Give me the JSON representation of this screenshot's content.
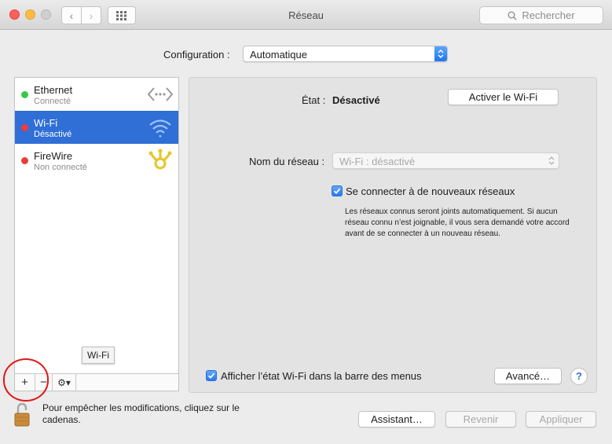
{
  "window": {
    "title": "Réseau"
  },
  "toolbar": {
    "back_glyph": "‹",
    "forward_glyph": "›",
    "grid_icon": "grid-icon",
    "search_placeholder": "Rechercher"
  },
  "config": {
    "label": "Configuration :",
    "value": "Automatique"
  },
  "services": [
    {
      "name": "Ethernet",
      "status": "Connecté",
      "dot_color": "#35c94a",
      "icon": "ethernet-icon"
    },
    {
      "name": "Wi-Fi",
      "status": "Désactivé",
      "dot_color": "#ee3b3b",
      "icon": "wifi-icon",
      "selected": true
    },
    {
      "name": "FireWire",
      "status": "Non connecté",
      "dot_color": "#ee3b3b",
      "icon": "firewire-icon"
    }
  ],
  "sidebar_footer": {
    "add": "+",
    "remove": "−",
    "action": "⚙▾"
  },
  "tooltip": "Wi-Fi",
  "detail": {
    "state_label": "État :",
    "state_value": "Désactivé",
    "activate_button": "Activer le Wi-Fi",
    "network_name_label": "Nom du réseau :",
    "network_name_value": "Wi-Fi : désactivé",
    "join_new_label": "Se connecter à de nouveaux réseaux",
    "join_new_checked": true,
    "join_new_note": "Les réseaux connus seront joints automatiquement. Si aucun réseau connu n’est joignable, il vous sera demandé votre accord avant de se connecter à un nouveau réseau.",
    "show_menubar_label": "Afficher l’état Wi-Fi dans la barre des menus",
    "show_menubar_checked": true,
    "advanced_button": "Avancé…",
    "help_glyph": "?"
  },
  "bottom": {
    "lock_text": "Pour empêcher les modifications, cliquez sur le cadenas.",
    "assistant_button": "Assistant…",
    "revert_button": "Revenir",
    "apply_button": "Appliquer"
  },
  "colors": {
    "selection": "#2f6fd6",
    "accent": "#2b78f0",
    "annotation_circle": "#e01818"
  }
}
